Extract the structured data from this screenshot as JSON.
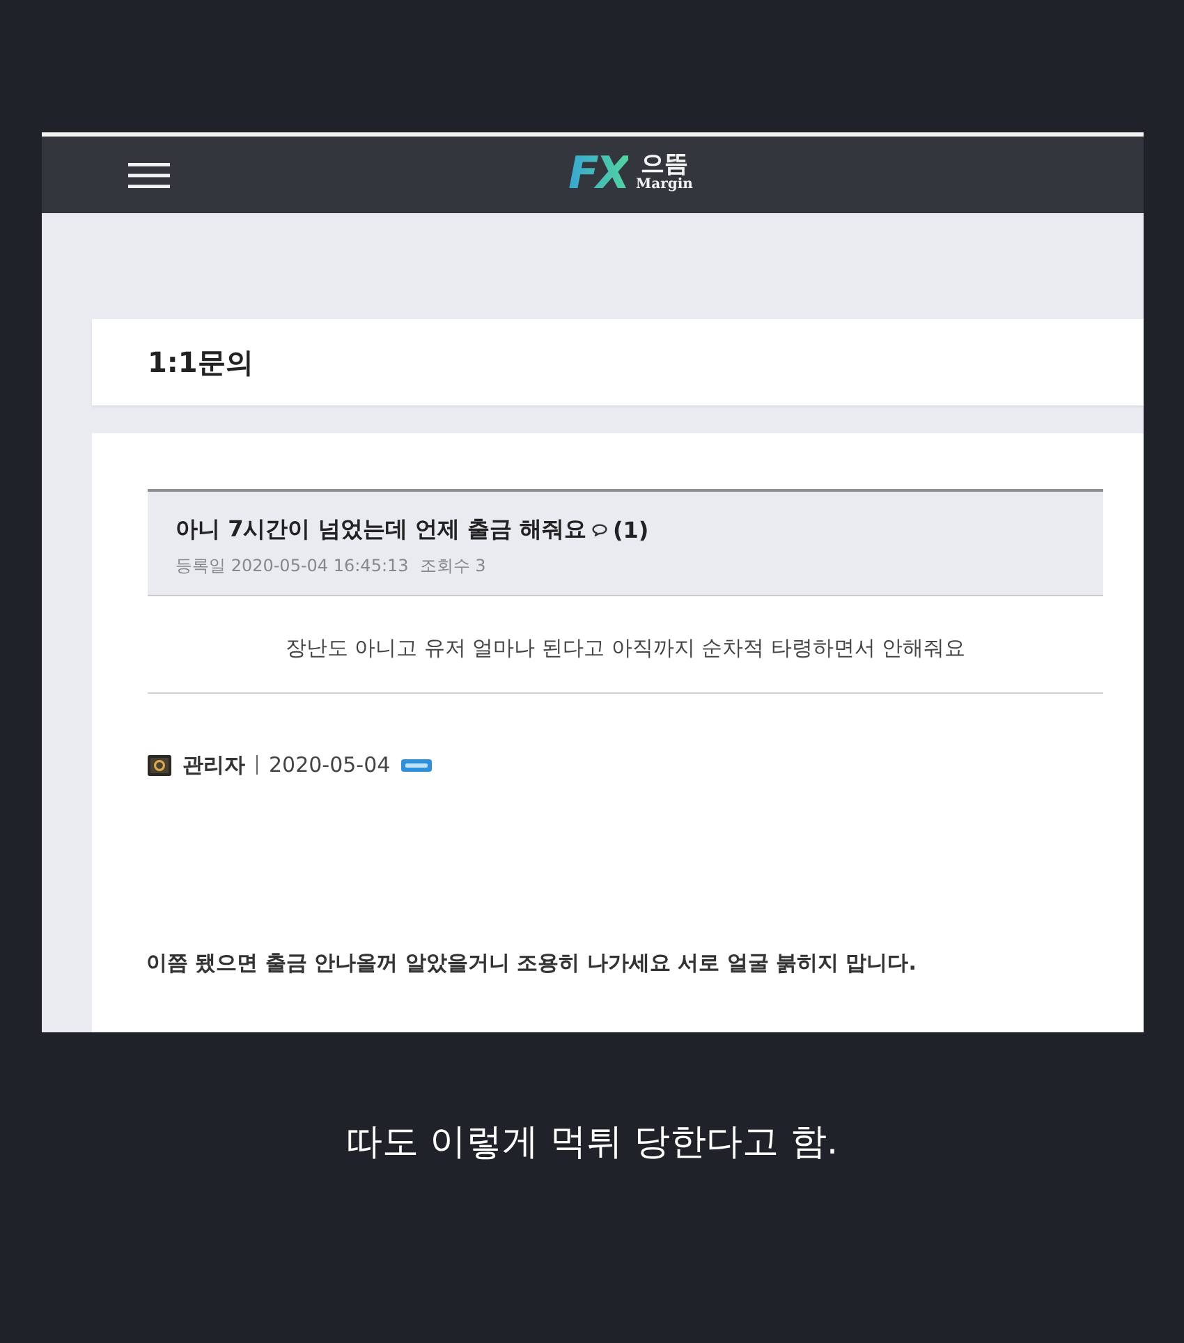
{
  "header": {
    "logo": {
      "mark": "FX",
      "name": "으뜸",
      "tagline": "Margin"
    }
  },
  "page_title": "1:1문의",
  "post": {
    "title": "아니 7시간이 넘었는데 언제 출금 해줘요",
    "comment_count": "(1)",
    "registered": "등록일 2020-05-04 16:45:13",
    "views": "조회수 3",
    "body": "장난도 아니고 유저 얼마나 된다고 아직까지 순차적 타령하면서 안해줘요"
  },
  "reply": {
    "author": "관리자",
    "date": "2020-05-04",
    "is_new": true,
    "body": "이쯤 됐으면 출금 안나올꺼 알았을거니 조용히 나가세요 서로 얼굴 붉히지 맙니다."
  },
  "caption": "따도 이렇게 먹튀 당한다고 함."
}
